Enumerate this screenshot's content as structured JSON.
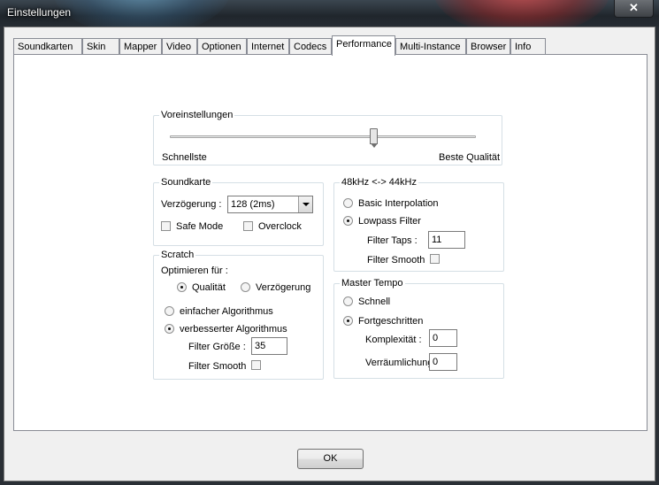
{
  "window": {
    "title": "Einstellungen",
    "close_glyph": "✕"
  },
  "tabs": [
    {
      "label": "Soundkarten"
    },
    {
      "label": "Skin"
    },
    {
      "label": "Mapper"
    },
    {
      "label": "Video"
    },
    {
      "label": "Optionen"
    },
    {
      "label": "Internet"
    },
    {
      "label": "Codecs"
    },
    {
      "label": "Performance",
      "active": true
    },
    {
      "label": "Multi-Instance"
    },
    {
      "label": "Browser"
    },
    {
      "label": "Info"
    }
  ],
  "presets": {
    "title": "Voreinstellungen",
    "left_label": "Schnellste",
    "right_label": "Beste Qualität",
    "slider_value": 0.7
  },
  "soundcard": {
    "title": "Soundkarte",
    "latency_label": "Verzögerung :",
    "latency_value": "128 (2ms)",
    "safe_mode_label": "Safe Mode",
    "safe_mode_checked": false,
    "overclock_label": "Overclock",
    "overclock_checked": false
  },
  "scratch": {
    "title": "Scratch",
    "optimize_label": "Optimieren für :",
    "quality_label": "Qualität",
    "delay_label": "Verzögerung",
    "optimize_selected": "quality",
    "simple_algo_label": "einfacher Algorithmus",
    "improved_algo_label": "verbesserter Algorithmus",
    "algo_selected": "improved",
    "filter_size_label": "Filter Größe :",
    "filter_size_value": "35",
    "filter_smooth_label": "Filter Smooth",
    "filter_smooth_checked": false
  },
  "resample": {
    "title": "48kHz <-> 44kHz",
    "basic_label": "Basic Interpolation",
    "lowpass_label": "Lowpass Filter",
    "selected": "lowpass",
    "filter_taps_label": "Filter Taps :",
    "filter_taps_value": "11",
    "filter_smooth_label": "Filter Smooth",
    "filter_smooth_checked": false
  },
  "master_tempo": {
    "title": "Master Tempo",
    "fast_label": "Schnell",
    "advanced_label": "Fortgeschritten",
    "selected": "advanced",
    "complexity_label": "Komplexität :",
    "complexity_value": "0",
    "spatial_label": "Verräumlichung",
    "spatial_value": "0"
  },
  "buttons": {
    "ok_label": "OK"
  }
}
